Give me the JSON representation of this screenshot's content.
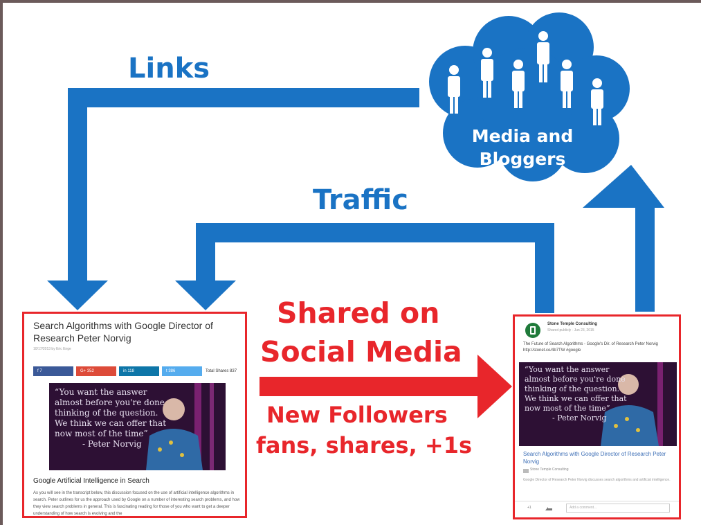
{
  "labels": {
    "links": "Links",
    "traffic": "Traffic",
    "cloud_line1": "Media and",
    "cloud_line2": "Bloggers",
    "shared_line1": "Shared on",
    "shared_line2": "Social Media",
    "followers_line1": "New Followers",
    "followers_line2": "fans, shares, +1s"
  },
  "article": {
    "title": "Search Algorithms with Google Director of Research Peter Norvig",
    "meta": "10/17/2013 by Eric Enge",
    "shares": [
      {
        "name": "facebook",
        "label": "f   7",
        "color": "#3b5998"
      },
      {
        "name": "googleplus",
        "label": "G+  352",
        "color": "#dd4b39"
      },
      {
        "name": "linkedin",
        "label": "in   118",
        "color": "#0e76a8"
      },
      {
        "name": "twitter",
        "label": "t   386",
        "color": "#55acee"
      }
    ],
    "total": "Total Shares 837",
    "quote_lines": [
      "“You want the answer",
      "almost before you're done",
      "thinking of the question.",
      "We think we can offer that",
      "now most of the time”",
      "- Peter Norvig"
    ],
    "subtitle": "Google Artificial Intelligence in Search",
    "body": "As you will see in the transcript below, this discussion focused on the use of artificial intelligence algorithms in search. Peter outlines for us the approach used by Google on a number of interesting search problems, and how they view search problems in general. This is fascinating reading for those of you who want to get a deeper understanding of how search is evolving and the"
  },
  "post": {
    "name": "Stone Temple Consulting",
    "meta": "Shared publicly · Jun 23, 2015",
    "text": "The Future of Search Algorithms - Google's Dir. of Research Peter Norvig http://stonet.co/4b7TW #google",
    "quote_lines": [
      "“You want the answer",
      "almost before you're done",
      "thinking of the question.",
      "We think we can offer that",
      "now most of the time”",
      "- Peter Norvig"
    ],
    "link_title": "Search Algorithms with Google Director of Research Peter Norvig",
    "source": "Stone Temple Consulting",
    "desc": "Google Director of Research Peter Norvig discusses search algorithms and artificial intelligence.",
    "plus_one": "+1",
    "comment_placeholder": "Add a comment..."
  },
  "colors": {
    "blue": "#1a73c4",
    "red": "#e8262b"
  }
}
